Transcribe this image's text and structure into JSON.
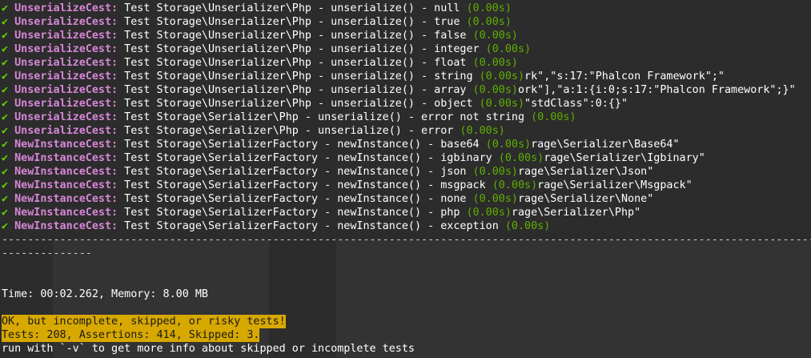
{
  "colors": {
    "background": "#2c2c2c",
    "check": "#5fd700",
    "cest": "#d787d7",
    "time": "#5faf00",
    "warning_bg": "#d7a800"
  },
  "check_glyph": "✔",
  "tests": [
    {
      "cest": "UnserializeCest:",
      "desc": " Test Storage\\Unserializer\\Php - unserialize() - null ",
      "time": "(0.00s)",
      "tail": ""
    },
    {
      "cest": "UnserializeCest:",
      "desc": " Test Storage\\Unserializer\\Php - unserialize() - true ",
      "time": "(0.00s)",
      "tail": ""
    },
    {
      "cest": "UnserializeCest:",
      "desc": " Test Storage\\Unserializer\\Php - unserialize() - false ",
      "time": "(0.00s)",
      "tail": ""
    },
    {
      "cest": "UnserializeCest:",
      "desc": " Test Storage\\Unserializer\\Php - unserialize() - integer ",
      "time": "(0.00s)",
      "tail": ""
    },
    {
      "cest": "UnserializeCest:",
      "desc": " Test Storage\\Unserializer\\Php - unserialize() - float ",
      "time": "(0.00s)",
      "tail": ""
    },
    {
      "cest": "UnserializeCest:",
      "desc": " Test Storage\\Unserializer\\Php - unserialize() - string ",
      "time": "(0.00s)",
      "tail": "rk\",\"s:17:\"Phalcon Framework\";\""
    },
    {
      "cest": "UnserializeCest:",
      "desc": " Test Storage\\Unserializer\\Php - unserialize() - array ",
      "time": "(0.00s)",
      "tail": "ork\"],\"a:1:{i:0;s:17:\"Phalcon Framework\";}\""
    },
    {
      "cest": "UnserializeCest:",
      "desc": " Test Storage\\Unserializer\\Php - unserialize() - object ",
      "time": "(0.00s)",
      "tail": "\"stdClass\":0:{}\""
    },
    {
      "cest": "UnserializeCest:",
      "desc": " Test Storage\\Serializer\\Php - unserialize() - error not string ",
      "time": "(0.00s)",
      "tail": ""
    },
    {
      "cest": "UnserializeCest:",
      "desc": " Test Storage\\Serializer\\Php - unserialize() - error ",
      "time": "(0.00s)",
      "tail": ""
    },
    {
      "cest": "NewInstanceCest:",
      "desc": " Test Storage\\SerializerFactory - newInstance() - base64 ",
      "time": "(0.00s)",
      "tail": "rage\\Serializer\\Base64\""
    },
    {
      "cest": "NewInstanceCest:",
      "desc": " Test Storage\\SerializerFactory - newInstance() - igbinary ",
      "time": "(0.00s)",
      "tail": "rage\\Serializer\\Igbinary\""
    },
    {
      "cest": "NewInstanceCest:",
      "desc": " Test Storage\\SerializerFactory - newInstance() - json ",
      "time": "(0.00s)",
      "tail": "rage\\Serializer\\Json\""
    },
    {
      "cest": "NewInstanceCest:",
      "desc": " Test Storage\\SerializerFactory - newInstance() - msgpack ",
      "time": "(0.00s)",
      "tail": "rage\\Serializer\\Msgpack\""
    },
    {
      "cest": "NewInstanceCest:",
      "desc": " Test Storage\\SerializerFactory - newInstance() - none ",
      "time": "(0.00s)",
      "tail": "rage\\Serializer\\None\""
    },
    {
      "cest": "NewInstanceCest:",
      "desc": " Test Storage\\SerializerFactory - newInstance() - php ",
      "time": "(0.00s)",
      "tail": "rage\\Serializer\\Php\""
    },
    {
      "cest": "NewInstanceCest:",
      "desc": " Test Storage\\SerializerFactory - newInstance() - exception ",
      "time": "(0.00s)",
      "tail": ""
    }
  ],
  "separator_1": "------------------------------------------------------------------------------------------------------------------------------------------------------------------------",
  "separator_2": "--------------",
  "summary_time": "Time: 00:02.262, Memory: 8.00 MB",
  "warning_line_1": "OK, but incomplete, skipped, or risky tests!",
  "warning_line_2": "Tests: 208, Assertions: 414, Skipped: 3.",
  "hint_line": "run with `-v` to get more info about skipped or incomplete tests"
}
